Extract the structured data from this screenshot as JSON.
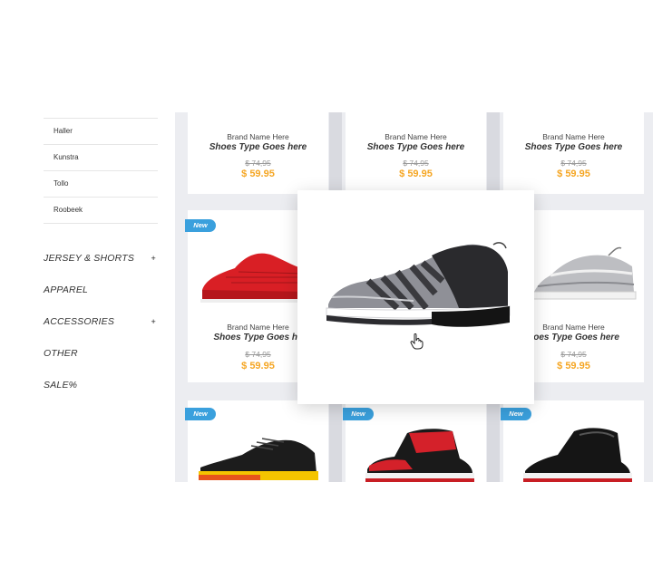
{
  "sidebar": {
    "brands": [
      "Haller",
      "Kunstra",
      "Tollo",
      "Roobeek"
    ],
    "categories": [
      {
        "label": "JERSEY & SHORTS",
        "expand": "+"
      },
      {
        "label": "APPAREL",
        "expand": ""
      },
      {
        "label": "ACCESSORIES",
        "expand": "+"
      },
      {
        "label": "OTHER",
        "expand": ""
      },
      {
        "label": "SALE%",
        "expand": ""
      }
    ]
  },
  "products": {
    "brand": "Brand Name Here",
    "type": "Shoes Type Goes here",
    "type_cut": "Shoes Type Goes he",
    "type_cut_right": "hoes Type Goes here",
    "old_price": "$ 74,95",
    "price": "$ 59.95",
    "badge": "New"
  },
  "colors": {
    "accent_price": "#f5a623",
    "badge_blue": "#3aa0dd",
    "grid_bg": "#ecedf1"
  },
  "icons": [
    "hand-pointer-icon",
    "plus-icon",
    "shoe-image"
  ]
}
